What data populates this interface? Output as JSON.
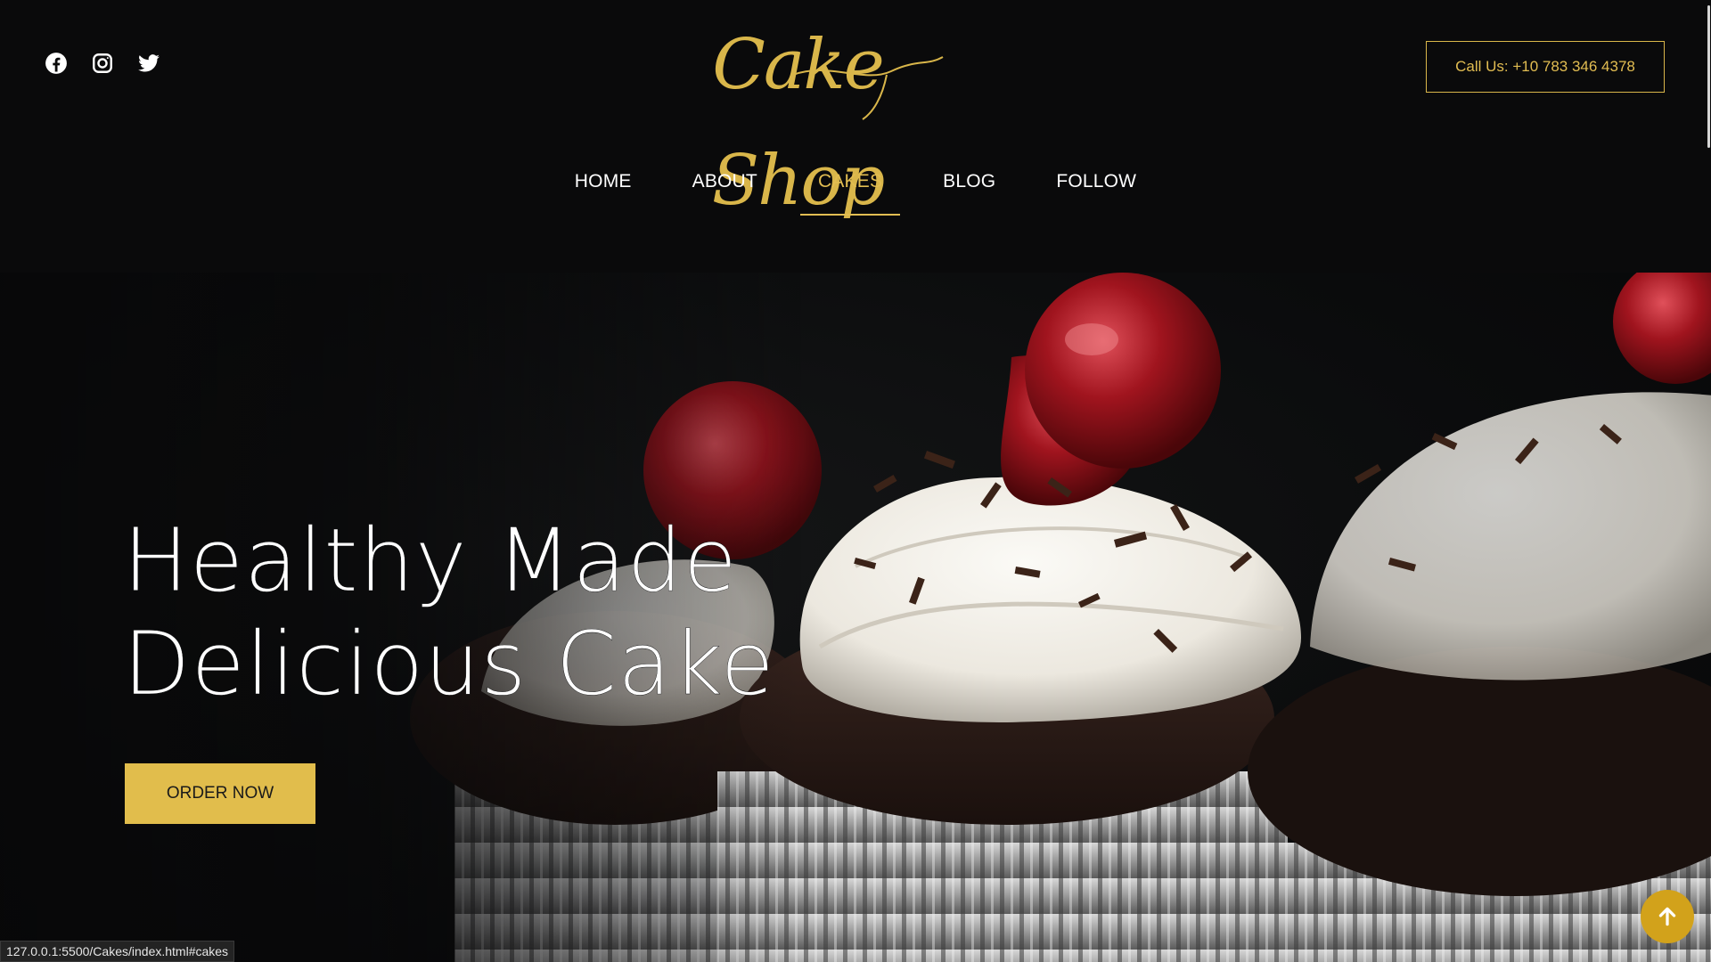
{
  "header": {
    "socials": [
      {
        "icon": "facebook-icon"
      },
      {
        "icon": "instagram-icon"
      },
      {
        "icon": "twitter-icon"
      }
    ],
    "logo_text": "Cake Shop",
    "call_label": "Call Us: +10 783 346 4378",
    "nav": [
      {
        "label": "HOME",
        "active": false
      },
      {
        "label": "ABOUT",
        "active": false
      },
      {
        "label": "CAKES",
        "active": true
      },
      {
        "label": "BLOG",
        "active": false
      },
      {
        "label": "FOLLOW",
        "active": false
      }
    ]
  },
  "hero": {
    "title_line1": "Healthy Made",
    "title_line2": "Delicious Cake",
    "order_label": "ORDER NOW",
    "image_subject": "chocolate cupcakes with whipped cream and cherries"
  },
  "status_bar": {
    "url": "127.0.0.1:5500/Cakes/index.html#cakes"
  },
  "colors": {
    "accent": "#e1bd4c",
    "background": "#0a0a0b",
    "text": "#ffffff",
    "back_to_top": "#d2a21b"
  }
}
